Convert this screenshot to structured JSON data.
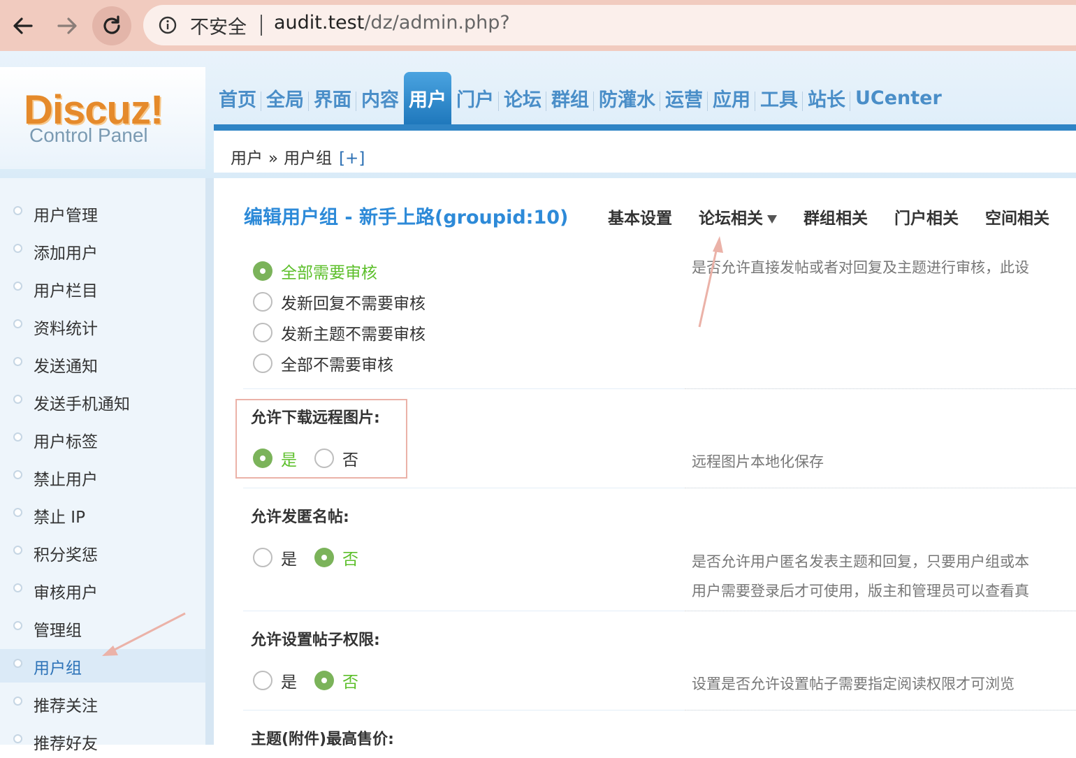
{
  "browser": {
    "insecure_label": "不安全",
    "url_host": "audit.test",
    "url_path": "/dz/admin.php?"
  },
  "logo": {
    "title": "Discuz!",
    "subtitle": "Control Panel"
  },
  "topnav": {
    "items": [
      "首页",
      "全局",
      "界面",
      "内容",
      "用户",
      "门户",
      "论坛",
      "群组",
      "防灌水",
      "运营",
      "应用",
      "工具",
      "站长",
      "UCenter"
    ],
    "active_index": 4
  },
  "breadcrumb": {
    "root": "用户",
    "separator": "»",
    "current": "用户组",
    "add": "[+]"
  },
  "sidebar": {
    "items": [
      "用户管理",
      "添加用户",
      "用户栏目",
      "资料统计",
      "发送通知",
      "发送手机通知",
      "用户标签",
      "禁止用户",
      "禁止 IP",
      "积分奖惩",
      "审核用户",
      "管理组",
      "用户组",
      "推荐关注",
      "推荐好友"
    ],
    "active_index": 12
  },
  "main": {
    "title": "编辑用户组 - 新手上路(groupid:10)",
    "tabs": [
      "基本设置",
      "论坛相关",
      "群组相关",
      "门户相关",
      "空间相关"
    ],
    "audit": {
      "options": [
        "全部需要审核",
        "发新回复不需要审核",
        "发新主题不需要审核",
        "全部不需要审核"
      ],
      "selected_index": 0,
      "desc": "是否允许直接发帖或者对回复及主题进行审核，此设"
    },
    "remote_images": {
      "title": "允许下载远程图片:",
      "yes": "是",
      "no": "否",
      "value": "是",
      "desc": "远程图片本地化保存"
    },
    "anonymous": {
      "title": "允许发匿名帖:",
      "yes": "是",
      "no": "否",
      "value": "否",
      "desc1": "是否允许用户匿名发表主题和回复，只要用户组或本",
      "desc2": "用户需要登录后才可使用，版主和管理员可以查看真"
    },
    "post_perm": {
      "title": "允许设置帖子权限:",
      "yes": "是",
      "no": "否",
      "value": "否",
      "desc": "设置是否允许设置帖子需要指定阅读权限才可浏览"
    },
    "max_price": {
      "title": "主题(附件)最高售价:"
    }
  },
  "colors": {
    "accent_blue": "#2d8ad8",
    "nav_active": "#1f78bc",
    "selected_green": "#5cbf2a",
    "annotation": "#ebb2a8"
  }
}
